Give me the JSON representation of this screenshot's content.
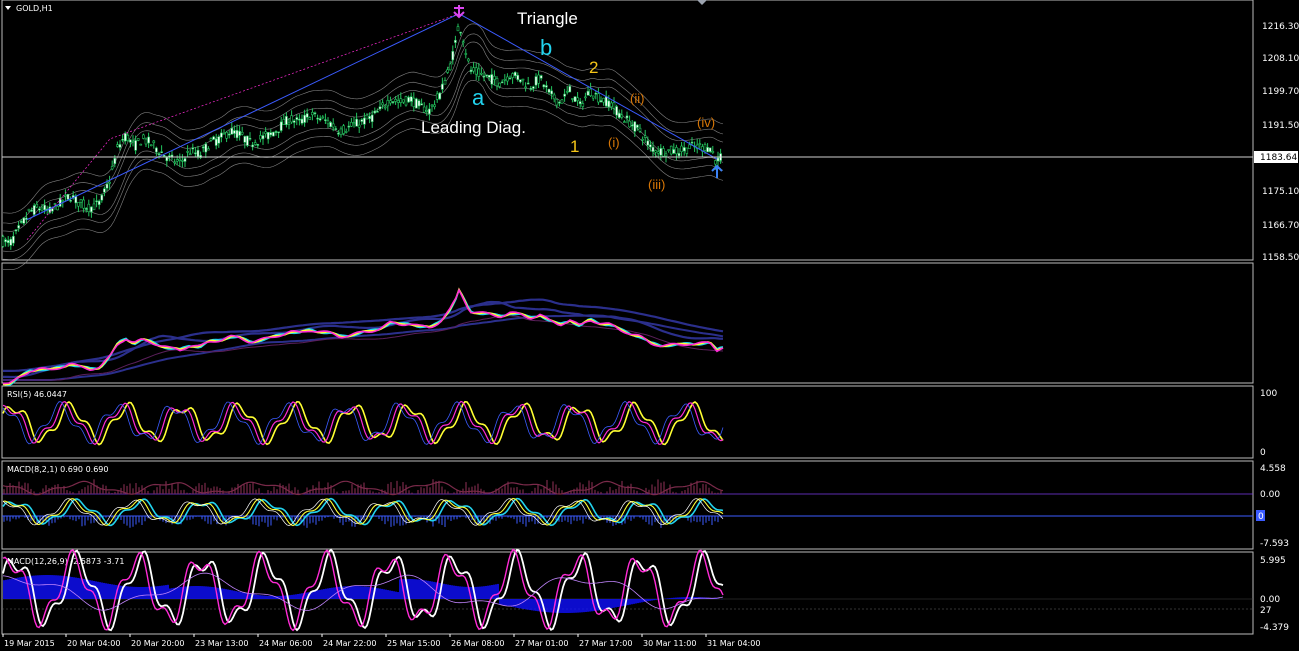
{
  "chart_data": {
    "type": "candlestick",
    "symbol_label": "GOLD,H1",
    "price_axis": {
      "ticks": [
        "1216.30",
        "1208.10",
        "1199.70",
        "1191.50",
        "1183.64",
        "1175.10",
        "1166.70",
        "1158.50"
      ],
      "current_price": "1183.64",
      "range": [
        1158.5,
        1220.4
      ]
    },
    "time_axis": [
      "19 Mar 2015",
      "20 Mar 04:00",
      "20 Mar 20:00",
      "23 Mar 13:00",
      "24 Mar 06:00",
      "24 Mar 22:00",
      "25 Mar 15:00",
      "26 Mar 08:00",
      "27 Mar 01:00",
      "27 Mar 17:00",
      "30 Mar 11:00",
      "31 Mar 04:00"
    ],
    "price_path": [
      [
        0,
        1163
      ],
      [
        10,
        1162
      ],
      [
        20,
        1166
      ],
      [
        30,
        1170
      ],
      [
        40,
        1171
      ],
      [
        50,
        1170
      ],
      [
        60,
        1172
      ],
      [
        70,
        1174
      ],
      [
        80,
        1172
      ],
      [
        90,
        1171
      ],
      [
        100,
        1172
      ],
      [
        110,
        1178
      ],
      [
        118,
        1186
      ],
      [
        126,
        1189
      ],
      [
        134,
        1186
      ],
      [
        142,
        1188
      ],
      [
        150,
        1187
      ],
      [
        160,
        1185
      ],
      [
        170,
        1183
      ],
      [
        180,
        1182
      ],
      [
        190,
        1185
      ],
      [
        200,
        1184
      ],
      [
        210,
        1187
      ],
      [
        220,
        1188
      ],
      [
        230,
        1190
      ],
      [
        240,
        1189
      ],
      [
        250,
        1187
      ],
      [
        260,
        1188
      ],
      [
        270,
        1189
      ],
      [
        280,
        1191
      ],
      [
        290,
        1193
      ],
      [
        300,
        1192
      ],
      [
        310,
        1194
      ],
      [
        320,
        1193
      ],
      [
        330,
        1192
      ],
      [
        340,
        1190
      ],
      [
        350,
        1191
      ],
      [
        360,
        1192
      ],
      [
        370,
        1193
      ],
      [
        380,
        1195
      ],
      [
        390,
        1198
      ],
      [
        400,
        1197
      ],
      [
        410,
        1198
      ],
      [
        420,
        1196
      ],
      [
        430,
        1195
      ],
      [
        440,
        1199
      ],
      [
        450,
        1206
      ],
      [
        456,
        1212
      ],
      [
        459,
        1217
      ],
      [
        463,
        1213
      ],
      [
        470,
        1205
      ],
      [
        480,
        1204
      ],
      [
        490,
        1203
      ],
      [
        500,
        1202
      ],
      [
        510,
        1204
      ],
      [
        520,
        1203
      ],
      [
        530,
        1201
      ],
      [
        540,
        1203
      ],
      [
        550,
        1199
      ],
      [
        560,
        1197
      ],
      [
        570,
        1200
      ],
      [
        580,
        1196
      ],
      [
        590,
        1200
      ],
      [
        600,
        1198
      ],
      [
        610,
        1197
      ],
      [
        620,
        1194
      ],
      [
        630,
        1192
      ],
      [
        640,
        1190
      ],
      [
        650,
        1186
      ],
      [
        660,
        1185
      ],
      [
        670,
        1185
      ],
      [
        680,
        1185
      ],
      [
        690,
        1186
      ],
      [
        700,
        1186
      ],
      [
        710,
        1186
      ],
      [
        717,
        1182
      ],
      [
        722,
        1184
      ]
    ],
    "trend_lines": [
      {
        "name": "up",
        "from": [
          27,
          1168
        ],
        "to": [
          459,
          1219
        ]
      },
      {
        "name": "down",
        "from": [
          459,
          1219
        ],
        "to": [
          717,
          1183
        ]
      }
    ],
    "annotations": [
      {
        "text": "Triangle",
        "color": "#ffffff"
      },
      {
        "text": "b",
        "color": "#22d3ee"
      },
      {
        "text": "a",
        "color": "#22d3ee"
      },
      {
        "text": "2",
        "color": "#f5c518"
      },
      {
        "text": "1",
        "color": "#f5c518"
      },
      {
        "text": "Leading Diag.",
        "color": "#ffffff"
      },
      {
        "text": "(ii)",
        "color": "#d97706"
      },
      {
        "text": "(i)",
        "color": "#d97706"
      },
      {
        "text": "(iii)",
        "color": "#d97706"
      },
      {
        "text": "(iv)",
        "color": "#d97706"
      }
    ],
    "indicators": [
      {
        "name": "moving-averages",
        "title": "",
        "axis": []
      },
      {
        "name": "rsi",
        "title": "RSI(5) 46.0447",
        "axis": [
          "100",
          "0"
        ]
      },
      {
        "name": "macd-fast",
        "title": "MACD(8,2,1) 0.690 0.690",
        "axis": [
          "4.558",
          "0.00",
          "-7.593"
        ],
        "marker": "0"
      },
      {
        "name": "macd-slow",
        "title": "MACD(12,26,9) -2.5873 -3.71",
        "axis": [
          "5.995",
          "0.00",
          "27",
          "-4.379"
        ]
      }
    ],
    "colors": {
      "candle": "#22c55e",
      "bands": "#a3a3a3",
      "trend": "#3b5bff",
      "white": "#ffffff",
      "magenta": "#ff2bd6",
      "cyan": "#22d3ee",
      "yellow": "#ffff33",
      "navy": "#2b2f8c",
      "blue": "#1010ff"
    }
  }
}
